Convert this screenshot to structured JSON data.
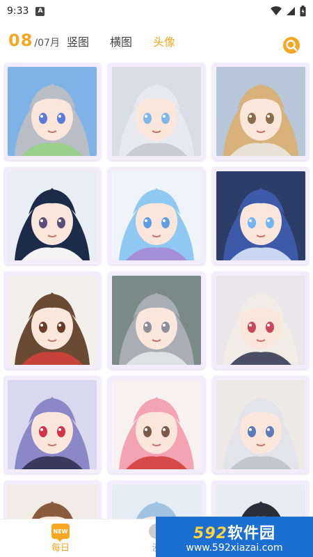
{
  "status_bar": {
    "time": "9:33",
    "notification_letter": "A"
  },
  "header": {
    "day": "08",
    "month": "/07月",
    "tabs": [
      {
        "label": "竖图",
        "active": false
      },
      {
        "label": "横图",
        "active": false
      },
      {
        "label": "头像",
        "active": true
      }
    ]
  },
  "grid": {
    "items": [
      {
        "hair": "#b9bdc6",
        "bg": "#7fb3e8",
        "eye": "#5b7bd6",
        "accent": "#9bd08a"
      },
      {
        "hair": "#e8e9ee",
        "bg": "#d9dde6",
        "eye": "#7fb8e8",
        "accent": "#c9ccd4"
      },
      {
        "hair": "#d8b27a",
        "bg": "#b7c6d9",
        "eye": "#8a6e4b",
        "accent": "#e8e2d6"
      },
      {
        "hair": "#1d2b4a",
        "bg": "#e9eef6",
        "eye": "#5c4e7a",
        "accent": "#f3f3f3"
      },
      {
        "hair": "#8fc9f2",
        "bg": "#eef4fa",
        "eye": "#5d9fe0",
        "accent": "#a48fd8"
      },
      {
        "hair": "#3c5aa8",
        "bg": "#2c3e68",
        "eye": "#6fb6f2",
        "accent": "#c9d8f0"
      },
      {
        "hair": "#6b4a33",
        "bg": "#f3f0ec",
        "eye": "#6b3b2a",
        "accent": "#c7433a"
      },
      {
        "hair": "#a9aeb4",
        "bg": "#7a8a86",
        "eye": "#8a8f99",
        "accent": "#dfe2e4"
      },
      {
        "hair": "#f1ece6",
        "bg": "#eae6ea",
        "eye": "#c9475a",
        "accent": "#4a4f66"
      },
      {
        "hair": "#8a88c6",
        "bg": "#d9d8ee",
        "eye": "#d2324a",
        "accent": "#3a3a5e"
      },
      {
        "hair": "#f4a3b3",
        "bg": "#f8f1f2",
        "eye": "#7a5a48",
        "accent": "#d64a4a"
      },
      {
        "hair": "#e2e4ea",
        "bg": "#ece9e6",
        "eye": "#5a7ab8",
        "accent": "#c4c6ce"
      },
      {
        "hair": "#8a5a3c",
        "bg": "#f2ece6",
        "eye": "#5a3a2a",
        "accent": "#d6b48a"
      },
      {
        "hair": "#9fc3e0",
        "bg": "#e4edf5",
        "eye": "#5c7ca8",
        "accent": "#c8d8e8"
      },
      {
        "hair": "#2a2e3a",
        "bg": "#e8ecf2",
        "eye": "#444",
        "accent": "#f2f2f2"
      }
    ]
  },
  "bottom_nav": {
    "daily_badge": "NEW",
    "daily_label": "每日",
    "comic_label": "漫"
  },
  "watermark": {
    "logo_num": "592",
    "logo_text": "软件园",
    "url": "www.592xiazai.com"
  },
  "colors": {
    "accent": "#f5a623",
    "card_bg": "#f3ecfb",
    "watermark_bg": "#1a6fd1"
  }
}
